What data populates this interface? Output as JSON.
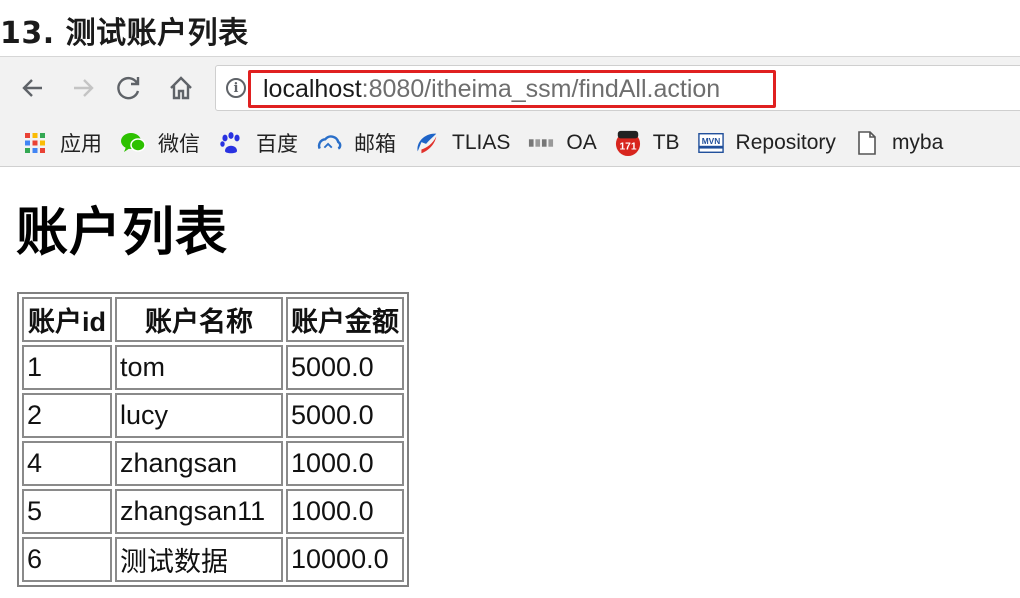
{
  "slide": {
    "title": "13. 测试账户列表"
  },
  "browser": {
    "url_host": "localhost",
    "url_rest": ":8080/itheima_ssm/findAll.action",
    "bookmarks": [
      {
        "label": "应用",
        "icon": "apps-grid-icon"
      },
      {
        "label": "微信",
        "icon": "wechat-icon"
      },
      {
        "label": "百度",
        "icon": "baidu-paw-icon"
      },
      {
        "label": "邮箱",
        "icon": "mail-cloud-icon"
      },
      {
        "label": "TLIAS",
        "icon": "tlias-icon"
      },
      {
        "label": "OA",
        "icon": "oa-icon"
      },
      {
        "label": "TB",
        "icon": "tb-badge-icon",
        "badge": "171"
      },
      {
        "label": "Repository",
        "icon": "mvn-icon",
        "badge": "MVN"
      },
      {
        "label": "myba",
        "icon": "page-icon"
      }
    ]
  },
  "page": {
    "heading": "账户列表",
    "table": {
      "headers": [
        "账户id",
        "账户名称",
        "账户金额"
      ],
      "rows": [
        [
          "1",
          "tom",
          "5000.0"
        ],
        [
          "2",
          "lucy",
          "5000.0"
        ],
        [
          "4",
          "zhangsan",
          "1000.0"
        ],
        [
          "5",
          "zhangsan11",
          "1000.0"
        ],
        [
          "6",
          "测试数据",
          "10000.0"
        ]
      ]
    }
  },
  "colors": {
    "highlight": "#e02020",
    "toolbar_bg": "#f2f2f2",
    "wechat_green": "#2dc100",
    "baidu_blue": "#2932e1"
  }
}
